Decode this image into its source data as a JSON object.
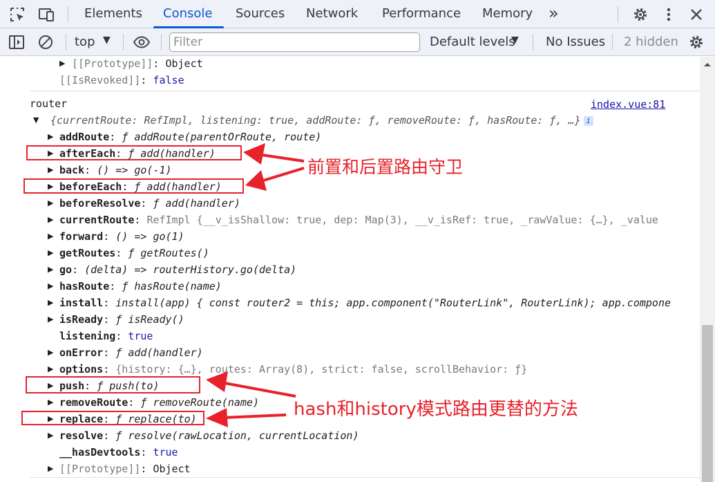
{
  "tabs": {
    "elements": "Elements",
    "console": "Console",
    "sources": "Sources",
    "network": "Network",
    "performance": "Performance",
    "memory": "Memory",
    "more": "»"
  },
  "toolbar": {
    "context": "top",
    "filter_placeholder": "Filter",
    "levels": "Default levels",
    "issues": "No Issues",
    "hidden": "2 hidden"
  },
  "console": {
    "proto_top_key": "[[Prototype]]",
    "proto_top_val": "Object",
    "revoked_key": "[[IsRevoked]]",
    "revoked_val": "false",
    "log_label": "router",
    "source_link": "index.vue:81",
    "summary": "{currentRoute: RefImpl, listening: true, addRoute: ƒ, removeRoute: ƒ, hasRoute: ƒ,  …}",
    "info": "i",
    "props": [
      {
        "key": "addRoute",
        "val": "ƒ addRoute(parentOrRoute, route)"
      },
      {
        "key": "afterEach",
        "val": "ƒ add(handler)"
      },
      {
        "key": "back",
        "val": "() => go(-1)"
      },
      {
        "key": "beforeEach",
        "val": "ƒ add(handler)"
      },
      {
        "key": "beforeResolve",
        "val": "ƒ add(handler)"
      },
      {
        "key": "currentRoute",
        "val": "RefImpl  {__v_isShallow: true, dep: Map(3), __v_isRef: true, _rawValue: {…}, _value"
      },
      {
        "key": "forward",
        "val": "() => go(1)"
      },
      {
        "key": "getRoutes",
        "val": "ƒ getRoutes()"
      },
      {
        "key": "go",
        "val": "(delta) => routerHistory.go(delta)"
      },
      {
        "key": "hasRoute",
        "val": "ƒ hasRoute(name)"
      },
      {
        "key": "install",
        "val": "install(app) { const router2 = this; app.component(\"RouterLink\", RouterLink); app.compone"
      },
      {
        "key": "isReady",
        "val": "ƒ isReady()"
      },
      {
        "key": "listening",
        "val": "true"
      },
      {
        "key": "onError",
        "val": "ƒ add(handler)"
      },
      {
        "key": "options",
        "val": "{history: {…}, routes: Array(8), strict: false, scrollBehavior: ƒ}"
      },
      {
        "key": "push",
        "val": "ƒ push(to)"
      },
      {
        "key": "removeRoute",
        "val": "ƒ removeRoute(name)"
      },
      {
        "key": "replace",
        "val": "ƒ replace(to)"
      },
      {
        "key": "resolve",
        "val": "ƒ resolve(rawLocation, currentLocation)"
      },
      {
        "key": "__hasDevtools",
        "val": "true"
      },
      {
        "key": "[[Prototype]]",
        "val": "Object"
      }
    ]
  },
  "annotations": {
    "guards_note": "前置和后置路由守卫",
    "history_note": "hash和history模式路由更替的方法",
    "color": "#e8212a"
  }
}
